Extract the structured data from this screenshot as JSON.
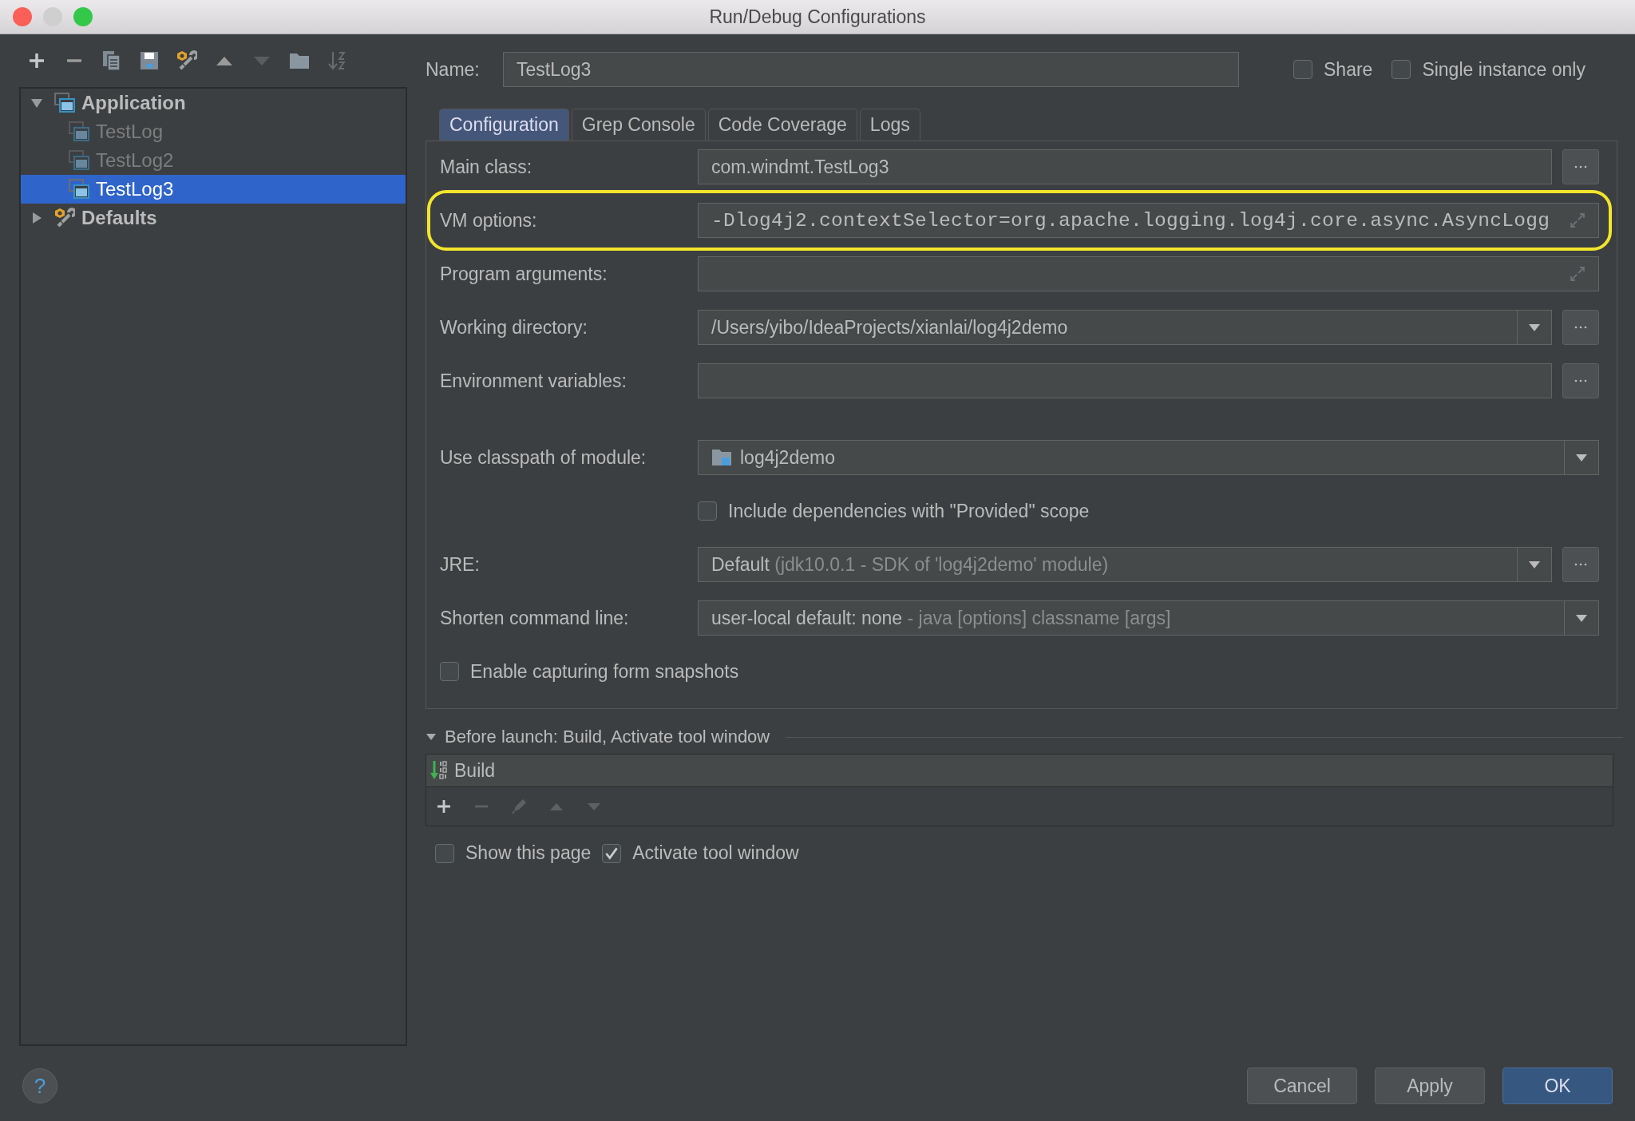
{
  "window": {
    "title": "Run/Debug Configurations"
  },
  "tree": [
    {
      "label": "Application",
      "kind": "group",
      "expanded": true,
      "selected": false,
      "children": [
        {
          "label": "TestLog",
          "kind": "config",
          "temporary": true,
          "selected": false
        },
        {
          "label": "TestLog2",
          "kind": "config",
          "temporary": true,
          "selected": false
        },
        {
          "label": "TestLog3",
          "kind": "config",
          "temporary": false,
          "selected": true
        }
      ]
    },
    {
      "label": "Defaults",
      "kind": "defaults",
      "expanded": false,
      "selected": false
    }
  ],
  "name_field": {
    "label": "Name:",
    "value": "TestLog3"
  },
  "options": [
    {
      "label": "Share",
      "checked": false
    },
    {
      "label": "Single instance only",
      "checked": false
    }
  ],
  "tabs": [
    {
      "label": "Configuration",
      "selected": true
    },
    {
      "label": "Grep Console",
      "selected": false
    },
    {
      "label": "Code Coverage",
      "selected": false
    },
    {
      "label": "Logs",
      "selected": false
    }
  ],
  "fields": [
    {
      "kind": "text",
      "label": "Main class:",
      "value": "com.windmt.TestLog3",
      "browse": true
    },
    {
      "kind": "expandable",
      "label": "VM options:",
      "value": "-Dlog4j2.contextSelector=org.apache.logging.log4j.core.async.AsyncLogg",
      "highlighted": true
    },
    {
      "kind": "expandable",
      "label": "Program arguments:"
    },
    {
      "kind": "combo",
      "label": "Working directory:",
      "value": "/Users/yibo/IdeaProjects/xianlai/log4j2demo",
      "browse": true
    },
    {
      "kind": "text",
      "label": "Environment variables:",
      "browse": true
    },
    {
      "kind": "module",
      "label": "Use classpath of module:",
      "value": "log4j2demo"
    },
    {
      "kind": "check",
      "label": "Include dependencies with \"Provided\" scope",
      "checked": false
    },
    {
      "kind": "combo",
      "label": "JRE:",
      "value": "Default",
      "hint": "(jdk10.0.1 - SDK of 'log4j2demo' module)",
      "browse": true
    },
    {
      "kind": "combo",
      "label": "Shorten command line:",
      "value": "user-local default: none",
      "hint": "- java [options] classname [args]"
    },
    {
      "kind": "wide_check",
      "label": "Enable capturing form snapshots",
      "checked": false
    }
  ],
  "before_launch": {
    "title": "Before launch: Build, Activate tool window",
    "expanded": true,
    "tasks": [
      {
        "label": "Build"
      }
    ]
  },
  "launch_options": [
    {
      "label": "Show this page",
      "checked": false
    },
    {
      "label": "Activate tool window",
      "checked": true
    }
  ],
  "help_button": {
    "label": "?"
  },
  "buttons": [
    {
      "label": "Cancel",
      "default": false
    },
    {
      "label": "Apply",
      "default": false
    },
    {
      "label": "OK",
      "default": true
    }
  ]
}
